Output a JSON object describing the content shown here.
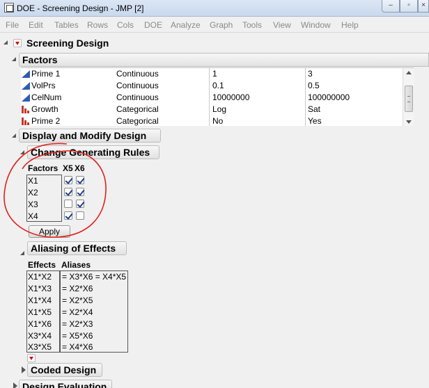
{
  "window": {
    "title": "DOE - Screening Design - JMP [2]",
    "min_glyph": "–",
    "max_glyph": "▫",
    "close_glyph": "×"
  },
  "menu": [
    "File",
    "Edit",
    "Tables",
    "Rows",
    "Cols",
    "DOE",
    "Analyze",
    "Graph",
    "Tools",
    "View",
    "Window",
    "Help"
  ],
  "report": {
    "title": "Screening Design",
    "factors": {
      "title": "Factors",
      "rows": [
        {
          "name": "Prime 1",
          "role": "Continuous",
          "low": "1",
          "high": "3",
          "icon": "continuous-icon"
        },
        {
          "name": "VolPrs",
          "role": "Continuous",
          "low": "0.1",
          "high": "0.5",
          "icon": "continuous-icon"
        },
        {
          "name": "CelNum",
          "role": "Continuous",
          "low": "10000000",
          "high": "100000000",
          "icon": "continuous-icon"
        },
        {
          "name": "Growth",
          "role": "Categorical",
          "low": "Log",
          "high": "Sat",
          "icon": "categorical-icon"
        },
        {
          "name": "Prime 2",
          "role": "Categorical",
          "low": "No",
          "high": "Yes",
          "icon": "categorical-icon"
        }
      ]
    },
    "display_modify": {
      "title": "Display and Modify Design",
      "generating_rules": {
        "title": "Change Generating Rules",
        "factors_header": "Factors",
        "col_headers": [
          "X5",
          "X6"
        ],
        "rows": [
          {
            "factor": "X1",
            "checks": [
              true,
              true
            ]
          },
          {
            "factor": "X2",
            "checks": [
              true,
              true
            ]
          },
          {
            "factor": "X3",
            "checks": [
              false,
              true
            ]
          },
          {
            "factor": "X4",
            "checks": [
              true,
              false
            ]
          }
        ],
        "apply_label": "Apply"
      },
      "aliasing": {
        "title": "Aliasing of Effects",
        "effects_header": "Effects",
        "aliases_header": "Aliases",
        "rows": [
          {
            "effect": "X1*X2",
            "alias": "= X3*X6 = X4*X5"
          },
          {
            "effect": "X1*X3",
            "alias": "= X2*X6"
          },
          {
            "effect": "X1*X4",
            "alias": "= X2*X5"
          },
          {
            "effect": "X1*X5",
            "alias": "= X2*X4"
          },
          {
            "effect": "X1*X6",
            "alias": "= X2*X3"
          },
          {
            "effect": "X3*X4",
            "alias": "= X5*X6"
          },
          {
            "effect": "X3*X5",
            "alias": "= X4*X6"
          }
        ]
      },
      "coded_design": {
        "title": "Coded Design"
      }
    },
    "design_evaluation": {
      "title": "Design Evaluation"
    }
  },
  "colors": {
    "annotation_circle": "#e0201b",
    "red_triangle": "#d01010",
    "continuous_icon": "#2f5bb5",
    "categorical_icon": "#c0392b"
  }
}
